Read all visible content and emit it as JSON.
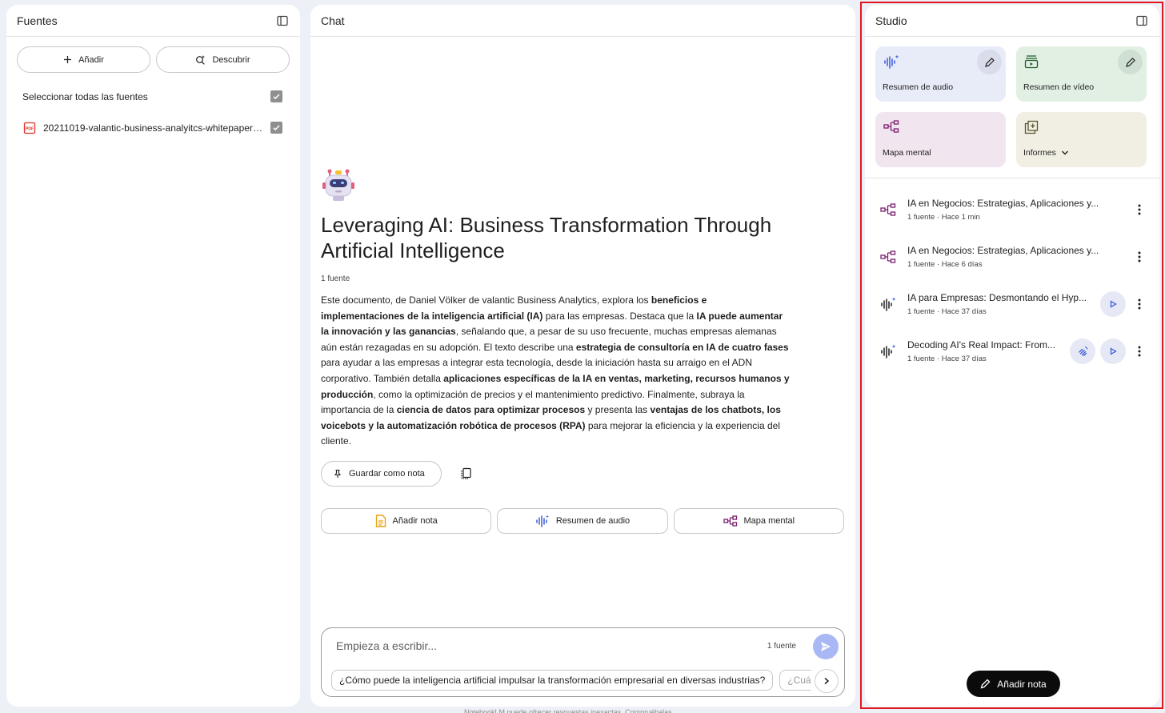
{
  "sources": {
    "title": "Fuentes",
    "add_label": "Añadir",
    "discover_label": "Descubrir",
    "select_all_label": "Seleccionar todas las fuentes",
    "items": [
      {
        "name": "20211019-valantic-business-analyitcs-whitepaper-...",
        "checked": true
      }
    ]
  },
  "chat": {
    "title": "Chat",
    "notebook_title": "Leveraging AI: Business Transformation Through Artificial Intelligence",
    "source_count": "1 fuente",
    "summary_parts": [
      {
        "text": "Este documento, de Daniel Völker de valantic Business Analytics, explora los ",
        "bold": false
      },
      {
        "text": "beneficios e implementaciones de la inteligencia artificial (IA)",
        "bold": true
      },
      {
        "text": " para las empresas. Destaca que la ",
        "bold": false
      },
      {
        "text": "IA puede aumentar la innovación y las ganancias",
        "bold": true
      },
      {
        "text": ", señalando que, a pesar de su uso frecuente, muchas empresas alemanas aún están rezagadas en su adopción. El texto describe una ",
        "bold": false
      },
      {
        "text": "estrategia de consultoría en IA de cuatro fases",
        "bold": true
      },
      {
        "text": " para ayudar a las empresas a integrar esta tecnología, desde la iniciación hasta su arraigo en el ADN corporativo. También detalla ",
        "bold": false
      },
      {
        "text": "aplicaciones específicas de la IA en ventas, marketing, recursos humanos y producción",
        "bold": true
      },
      {
        "text": ", como la optimización de precios y el mantenimiento predictivo. Finalmente, subraya la importancia de la ",
        "bold": false
      },
      {
        "text": "ciencia de datos para optimizar procesos",
        "bold": true
      },
      {
        "text": " y presenta las ",
        "bold": false
      },
      {
        "text": "ventajas de los chatbots, los voicebots y la automatización robótica de procesos (RPA)",
        "bold": true
      },
      {
        "text": " para mejorar la eficiencia y la experiencia del cliente.",
        "bold": false
      }
    ],
    "save_note_label": "Guardar como nota",
    "quick_actions": {
      "add_note": "Añadir nota",
      "audio_summary": "Resumen de audio",
      "mind_map": "Mapa mental"
    },
    "composer": {
      "placeholder": "Empieza a escribir...",
      "source_count": "1 fuente",
      "suggestions": [
        "¿Cómo puede la inteligencia artificial impulsar la transformación empresarial en diversas industrias?",
        "¿Cuáles son"
      ]
    },
    "footer": "NotebookLM puede ofrecer respuestas inexactas. Compruébalas."
  },
  "studio": {
    "title": "Studio",
    "tiles": {
      "audio": "Resumen de audio",
      "video": "Resumen de vídeo",
      "mind_map": "Mapa mental",
      "reports": "Informes"
    },
    "items": [
      {
        "type": "mindmap",
        "title": "IA en Negocios: Estrategias, Aplicaciones y...",
        "meta": "1 fuente · Hace 1 min"
      },
      {
        "type": "mindmap",
        "title": "IA en Negocios: Estrategias, Aplicaciones y...",
        "meta": "1 fuente · Hace 6 días"
      },
      {
        "type": "audio",
        "title": "IA para Empresas: Desmontando el Hyp...",
        "meta": "1 fuente · Hace 37 días"
      },
      {
        "type": "audio",
        "title": "Decoding AI's Real Impact: From...",
        "meta": "1 fuente · Hace 37 días"
      }
    ],
    "add_note_label": "Añadir nota"
  },
  "colors": {
    "accent_blue": "#3b5bdb",
    "mindmap_purple": "#7a1c6e",
    "highlight_outline": "#e0161e"
  }
}
